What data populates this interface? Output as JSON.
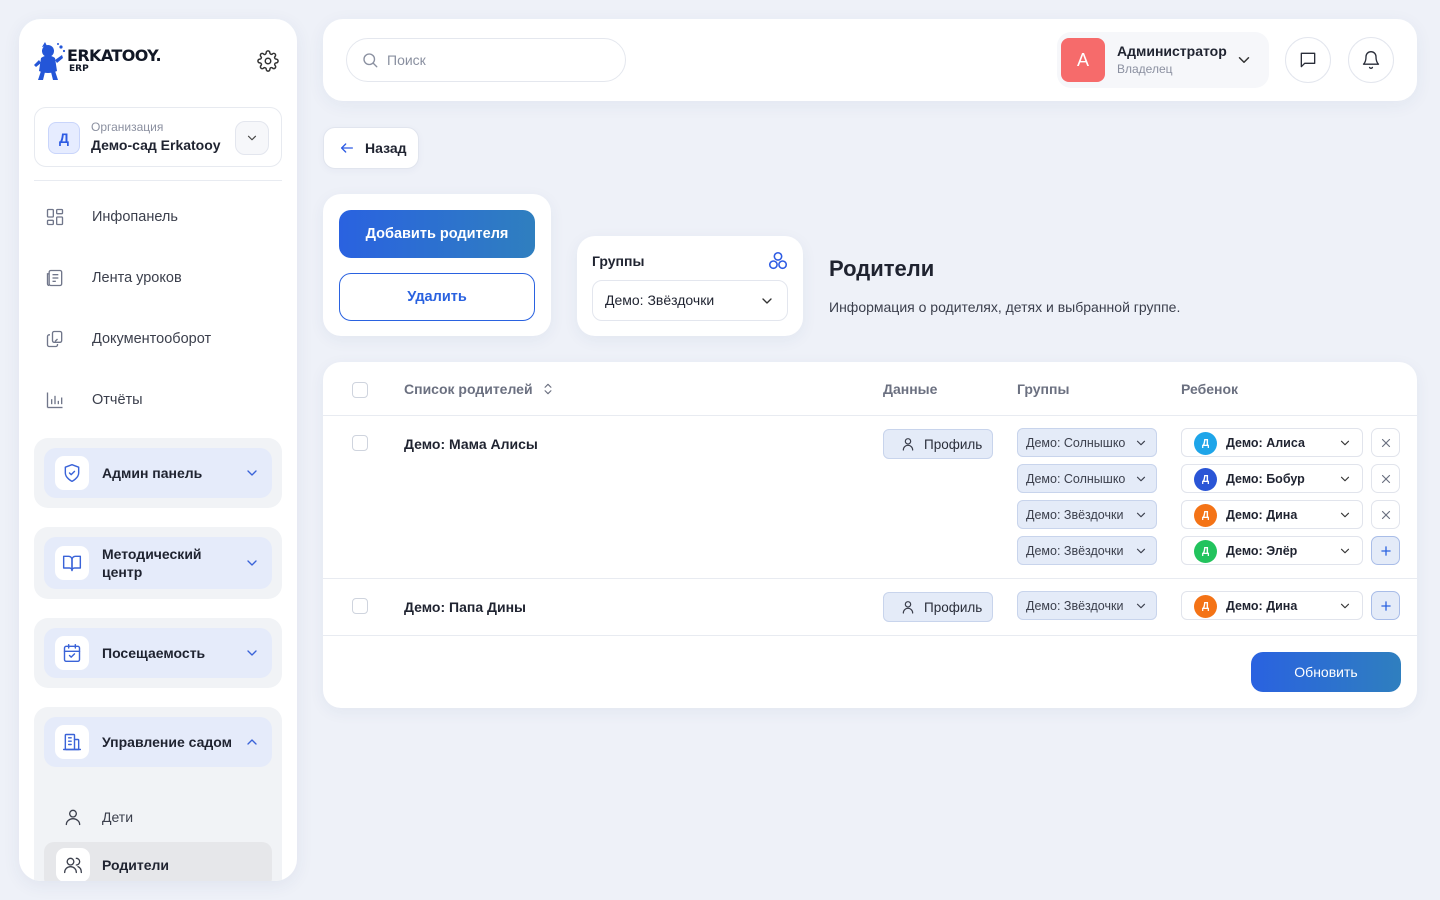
{
  "brand": {
    "name": "ERKATOOY.",
    "sub": "ERP"
  },
  "org": {
    "avatar": "Д",
    "label": "Организация",
    "name": "Демо-сад Erkatooy"
  },
  "nav": [
    {
      "label": "Инфопанель",
      "icon": "dashboard-icon"
    },
    {
      "label": "Лента уроков",
      "icon": "lessons-feed-icon"
    },
    {
      "label": "Документооборот",
      "icon": "documents-icon"
    },
    {
      "label": "Отчёты",
      "icon": "reports-icon"
    }
  ],
  "groups": {
    "admin": {
      "label": "Админ панель"
    },
    "methodical": {
      "label": "Методический центр"
    },
    "attendance": {
      "label": "Посещаемость"
    },
    "garden": {
      "label": "Управление садом",
      "items": [
        {
          "label": "Дети"
        },
        {
          "label": "Родители"
        }
      ]
    }
  },
  "search": {
    "placeholder": "Поиск",
    "value": ""
  },
  "user": {
    "avatar": "А",
    "name": "Администратор",
    "role": "Владелец",
    "avatar_color": "#f66b6b"
  },
  "back_label": "Назад",
  "actions": {
    "add": "Добавить родителя",
    "delete": "Удалить"
  },
  "group_filter": {
    "title": "Группы",
    "value": "Демо: Звёздочки"
  },
  "page": {
    "title": "Родители",
    "description": "Информация о родителях, детях и выбранной группе."
  },
  "table": {
    "columns": {
      "list": "Список родителей",
      "data": "Данные",
      "groups": "Группы",
      "child": "Ребенок"
    },
    "profile_label": "Профиль",
    "rows": [
      {
        "name": "Демо: Мама Алисы",
        "groups": [
          "Демо: Солнышко",
          "Демо: Солнышко",
          "Демо: Звёздочки",
          "Демо: Звёздочки"
        ],
        "children": [
          {
            "initial": "Д",
            "name": "Демо: Алиса",
            "color": "#1ea5e9"
          },
          {
            "initial": "Д",
            "name": "Демо: Бобур",
            "color": "#2a55d6"
          },
          {
            "initial": "Д",
            "name": "Демо: Дина",
            "color": "#f47316"
          },
          {
            "initial": "Д",
            "name": "Демо: Элёр",
            "color": "#22c35d"
          }
        ]
      },
      {
        "name": "Демо: Папа Дины",
        "groups": [
          "Демо: Звёздочки"
        ],
        "children": [
          {
            "initial": "Д",
            "name": "Демо: Дина",
            "color": "#f47316"
          }
        ]
      }
    ],
    "update_label": "Обновить"
  },
  "colors": {
    "accent": "#2a62e0",
    "background": "#eef1f8"
  }
}
